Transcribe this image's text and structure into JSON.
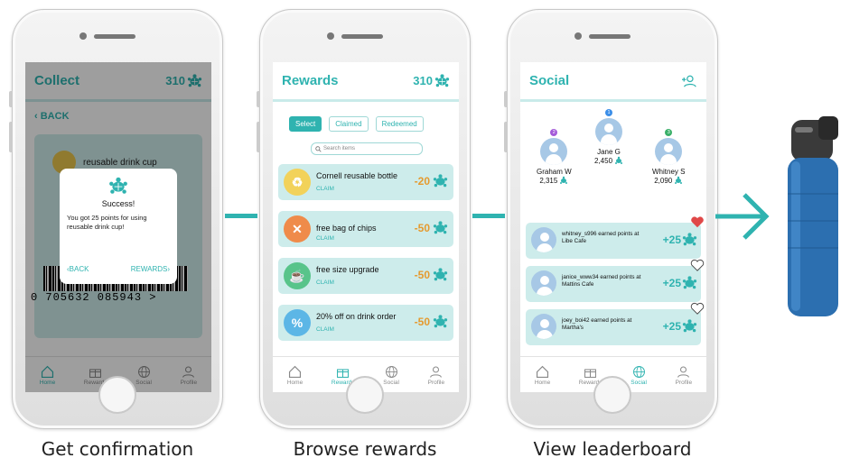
{
  "screen1": {
    "title": "Collect",
    "points": "310",
    "back": "BACK",
    "item": "reusable drink cup",
    "barcode": "0   705632   085943   >",
    "modal": {
      "title": "Success!",
      "body": "You got 25 points for using reusable drink cup!",
      "back_label": "BACK",
      "rewards_label": "REWARDS"
    },
    "nav": [
      "Home",
      "Rewards",
      "Social",
      "Profile"
    ]
  },
  "screen2": {
    "title": "Rewards",
    "points": "310",
    "tabs": [
      "Select",
      "Claimed",
      "Redeemed"
    ],
    "search_placeholder": "Search items",
    "rewards": [
      {
        "name": "Cornell reusable bottle",
        "claim": "CLAIM",
        "cost": "-20",
        "icon": "recycle-icon",
        "color": "#f2d25a"
      },
      {
        "name": "free bag of chips",
        "claim": "CLAIM",
        "cost": "-50",
        "icon": "utensils-icon",
        "color": "#ef8b4a"
      },
      {
        "name": "free size upgrade",
        "claim": "CLAIM",
        "cost": "-50",
        "icon": "coffee-cup-icon",
        "color": "#58c48a"
      },
      {
        "name": "20% off on drink order",
        "claim": "CLAIM",
        "cost": "-50",
        "icon": "percent-icon",
        "color": "#5cb6e6"
      }
    ],
    "nav": [
      "Home",
      "Rewards",
      "Social",
      "Profile"
    ]
  },
  "screen3": {
    "title": "Social",
    "leaders": [
      {
        "rank": "2",
        "name": "Graham W",
        "score": "2,315",
        "rank_color": "#a45bd9"
      },
      {
        "rank": "1",
        "name": "Jane G",
        "score": "2,450",
        "rank_color": "#3b8ee8"
      },
      {
        "rank": "3",
        "name": "Whitney S",
        "score": "2,090",
        "rank_color": "#3bb069"
      }
    ],
    "activities": [
      {
        "text": "whitney_s996 earned points at Libe Cafe",
        "points": "+25",
        "liked": true
      },
      {
        "text": "janice_www34 earned points at Mattins Cafe",
        "points": "+25",
        "liked": false
      },
      {
        "text": "joey_boi42 earned points at Martha's",
        "points": "+25",
        "liked": false
      }
    ],
    "nav": [
      "Home",
      "Rewards",
      "Social",
      "Profile"
    ]
  },
  "captions": [
    "Get confirmation",
    "Browse rewards",
    "View leaderboard"
  ],
  "colors": {
    "accent": "#2fb3b0",
    "card": "#cdeceb",
    "cost": "#e59a2e",
    "heart": "#e04848"
  }
}
